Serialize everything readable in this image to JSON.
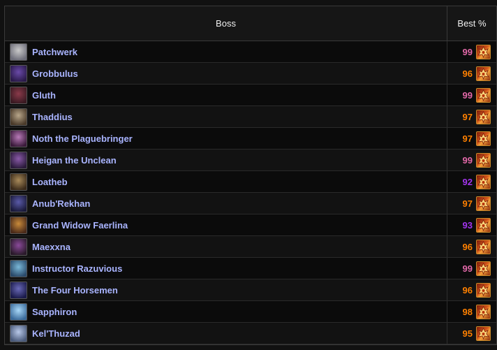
{
  "table": {
    "header": {
      "boss": "Boss",
      "best": "Best %"
    },
    "rows": [
      {
        "name": "Patchwerk",
        "best": "99",
        "color": "#e268a8",
        "portrait": [
          "#c9c9c9",
          "#6e6e7a"
        ]
      },
      {
        "name": "Grobbulus",
        "best": "96",
        "color": "#ff8000",
        "portrait": [
          "#6a4aa8",
          "#2a1a4a"
        ]
      },
      {
        "name": "Gluth",
        "best": "99",
        "color": "#e268a8",
        "portrait": [
          "#8a3a4a",
          "#3a1a22"
        ]
      },
      {
        "name": "Thaddius",
        "best": "97",
        "color": "#ff8000",
        "portrait": [
          "#b8a68a",
          "#4a3a2a"
        ]
      },
      {
        "name": "Noth the Plaguebringer",
        "best": "97",
        "color": "#ff8000",
        "portrait": [
          "#b87ab8",
          "#3a1a3a"
        ]
      },
      {
        "name": "Heigan the Unclean",
        "best": "99",
        "color": "#e268a8",
        "portrait": [
          "#8a5aa8",
          "#2a1a3a"
        ]
      },
      {
        "name": "Loatheb",
        "best": "92",
        "color": "#a335ee",
        "portrait": [
          "#a88a5a",
          "#3a2a1a"
        ]
      },
      {
        "name": "Anub'Rekhan",
        "best": "97",
        "color": "#ff8000",
        "portrait": [
          "#5a5aa8",
          "#1a1a3a"
        ]
      },
      {
        "name": "Grand Widow Faerlina",
        "best": "93",
        "color": "#a335ee",
        "portrait": [
          "#c88a3a",
          "#4a2a1a"
        ]
      },
      {
        "name": "Maexxna",
        "best": "96",
        "color": "#ff8000",
        "portrait": [
          "#8a4a9a",
          "#2a1a2a"
        ]
      },
      {
        "name": "Instructor Razuvious",
        "best": "99",
        "color": "#e268a8",
        "portrait": [
          "#7ab8d8",
          "#2a4a6a"
        ]
      },
      {
        "name": "The Four Horsemen",
        "best": "96",
        "color": "#ff8000",
        "portrait": [
          "#6a6ab8",
          "#1a1a4a"
        ]
      },
      {
        "name": "Sapphiron",
        "best": "98",
        "color": "#ff8000",
        "portrait": [
          "#a8d8f8",
          "#3a6a9a"
        ]
      },
      {
        "name": "Kel'Thuzad",
        "best": "95",
        "color": "#ff8000",
        "portrait": [
          "#b8c8e8",
          "#4a5a7a"
        ]
      }
    ],
    "spec_icon": "fire-mage-spec-icon"
  }
}
